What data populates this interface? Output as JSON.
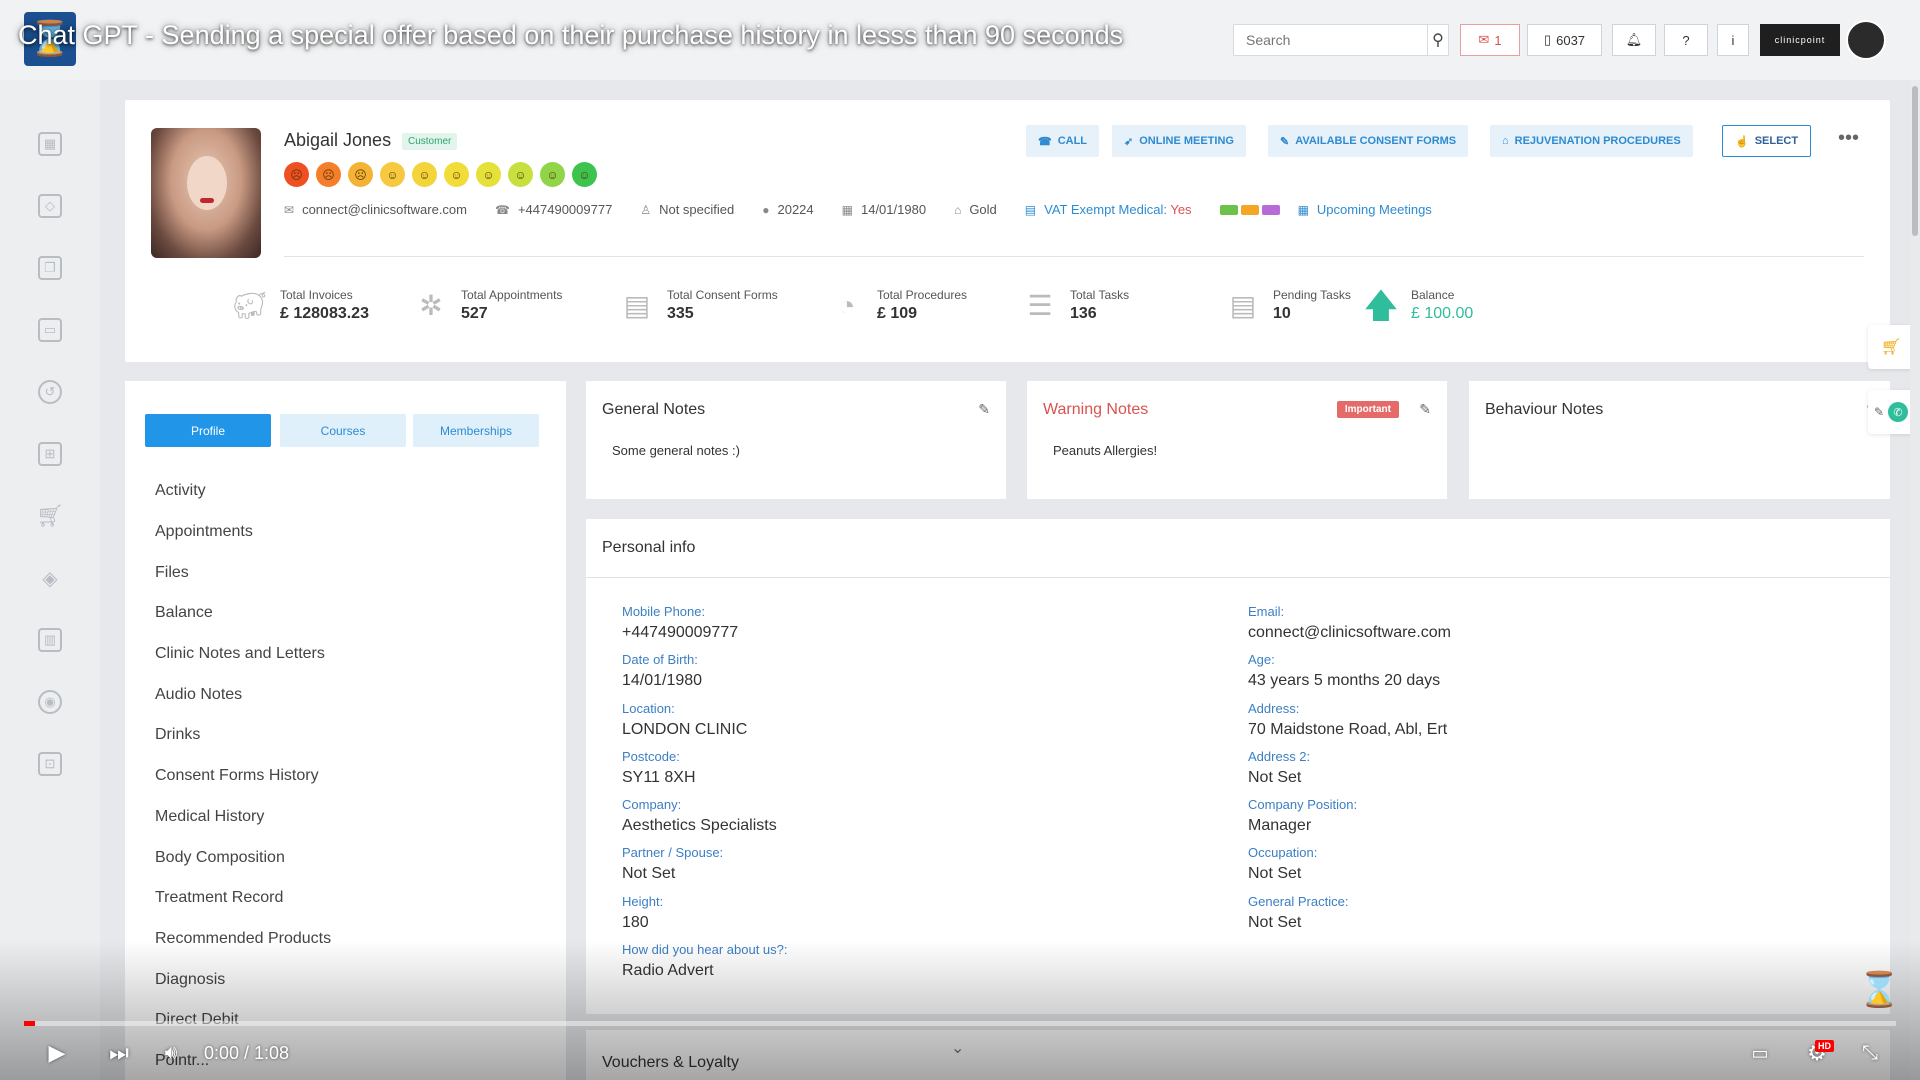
{
  "video": {
    "title": "Chat GPT - Sending a special offer based on their purchase history in lesss than 90 seconds",
    "time": "0:00 / 1:08",
    "progress_fraction": 0.006
  },
  "topbar": {
    "search_placeholder": "Search",
    "mail_count": "1",
    "phone_count": "6037",
    "brand": "clinicpoint"
  },
  "customer": {
    "name": "Abigail Jones",
    "badge": "Customer",
    "email": "connect@clinicsoftware.com",
    "phone": "+447490009777",
    "gender": "Not specified",
    "id": "20224",
    "dob": "14/01/1980",
    "tier": "Gold",
    "vat_label": "VAT Exempt Medical:",
    "vat_value": "Yes",
    "upcoming": "Upcoming Meetings",
    "chip_colors": [
      "#6cc24a",
      "#f5a623",
      "#b86ad8"
    ],
    "face_colors": [
      "#f04e23",
      "#f47e2a",
      "#f5b335",
      "#f6c940",
      "#f3d43a",
      "#f2dc3a",
      "#e5e13b",
      "#c7e03e",
      "#8fd547",
      "#3cc44f"
    ]
  },
  "actions": {
    "call": "CALL",
    "meeting": "ONLINE MEETING",
    "consent": "AVAILABLE CONSENT FORMS",
    "rejuvenation": "REJUVENATION PROCEDURES",
    "select": "SELECT"
  },
  "stats": [
    {
      "label": "Total Invoices",
      "value": "£ 128083.23"
    },
    {
      "label": "Total Appointments",
      "value": "527"
    },
    {
      "label": "Total Consent Forms",
      "value": "335"
    },
    {
      "label": "Total Procedures",
      "value": "£ 109"
    },
    {
      "label": "Total Tasks",
      "value": "136"
    },
    {
      "label": "Pending Tasks",
      "value": "10"
    },
    {
      "label": "Balance",
      "value": "£ 100.00"
    }
  ],
  "profile_tabs": {
    "profile": "Profile",
    "courses": "Courses",
    "memberships": "Memberships"
  },
  "profile_menu": [
    "Activity",
    "Appointments",
    "Files",
    "Balance",
    "Clinic Notes and Letters",
    "Audio Notes",
    "Drinks",
    "Consent Forms History",
    "Medical History",
    "Body Composition",
    "Treatment Record",
    "Recommended Products",
    "Diagnosis",
    "Direct Debit",
    "Pointr..."
  ],
  "notes": {
    "general_title": "General Notes",
    "general_text": "Some general notes :)",
    "warning_title": "Warning Notes",
    "warning_badge": "Important",
    "warning_text": "Peanuts Allergies!",
    "behaviour_title": "Behaviour Notes"
  },
  "personal_info": {
    "title": "Personal info",
    "left": [
      {
        "label": "Mobile Phone:",
        "value": "+447490009777"
      },
      {
        "label": "Date of Birth:",
        "value": "14/01/1980"
      },
      {
        "label": "Location:",
        "value": "LONDON CLINIC"
      },
      {
        "label": "Postcode:",
        "value": "SY11 8XH"
      },
      {
        "label": "Company:",
        "value": "Aesthetics Specialists"
      },
      {
        "label": "Partner / Spouse:",
        "value": "Not Set"
      },
      {
        "label": "Height:",
        "value": "180"
      },
      {
        "label": "How did you hear about us?:",
        "value": "Radio Advert"
      }
    ],
    "right": [
      {
        "label": "Email:",
        "value": "connect@clinicsoftware.com"
      },
      {
        "label": "Age:",
        "value": "43 years 5 months 20 days"
      },
      {
        "label": "Address:",
        "value": "70 Maidstone Road, Abl, Ert"
      },
      {
        "label": "Address 2:",
        "value": "Not Set"
      },
      {
        "label": "Company Position:",
        "value": "Manager"
      },
      {
        "label": "Occupation:",
        "value": "Not Set"
      },
      {
        "label": "General Practice:",
        "value": "Not Set"
      }
    ]
  },
  "vouchers": {
    "title": "Vouchers & Loyalty"
  }
}
